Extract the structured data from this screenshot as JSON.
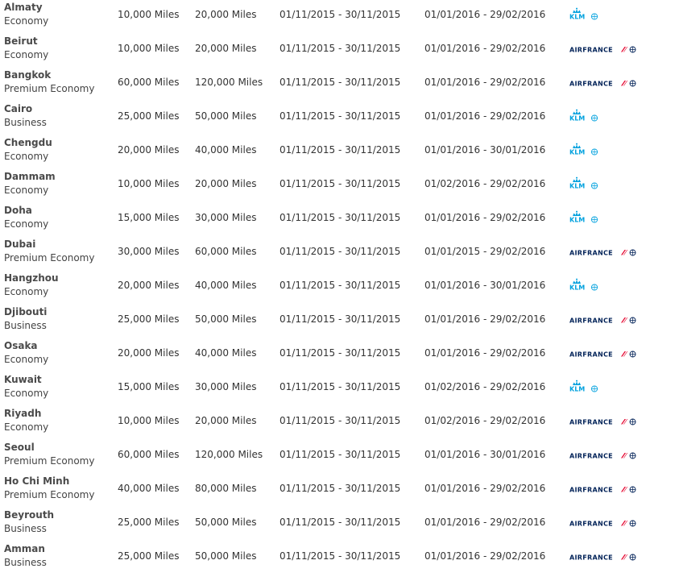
{
  "colors": {
    "klm_blue": "#00a1de",
    "airfrance_navy": "#002157",
    "airfrance_red": "#e4002b",
    "text": "#333333"
  },
  "rows": [
    {
      "city": "Almaty",
      "cabin": "Economy",
      "miles_low": "10,000 Miles",
      "miles_high": "20,000 Miles",
      "booking_period": "01/11/2015 - 30/11/2015",
      "travel_period": "01/01/2016 - 29/02/2016",
      "airline": "KLM",
      "logo_icon": "klm-logo-icon"
    },
    {
      "city": "Beirut",
      "cabin": "Economy",
      "miles_low": "10,000 Miles",
      "miles_high": "20,000 Miles",
      "booking_period": "01/11/2015 - 30/11/2015",
      "travel_period": "01/01/2016 - 29/02/2016",
      "airline": "AIRFRANCE",
      "logo_icon": "airfrance-logo-icon"
    },
    {
      "city": "Bangkok",
      "cabin": "Premium Economy",
      "miles_low": "60,000 Miles",
      "miles_high": "120,000 Miles",
      "booking_period": "01/11/2015 - 30/11/2015",
      "travel_period": "01/01/2016 - 29/02/2016",
      "airline": "AIRFRANCE",
      "logo_icon": "airfrance-logo-icon"
    },
    {
      "city": "Cairo",
      "cabin": "Business",
      "miles_low": "25,000 Miles",
      "miles_high": "50,000 Miles",
      "booking_period": "01/11/2015 - 30/11/2015",
      "travel_period": "01/01/2016 - 29/02/2016",
      "airline": "KLM",
      "logo_icon": "klm-logo-icon"
    },
    {
      "city": "Chengdu",
      "cabin": "Economy",
      "miles_low": "20,000 Miles",
      "miles_high": "40,000 Miles",
      "booking_period": "01/11/2015 - 30/11/2015",
      "travel_period": "01/01/2016 - 30/01/2016",
      "airline": "KLM",
      "logo_icon": "klm-logo-icon"
    },
    {
      "city": "Dammam",
      "cabin": "Economy",
      "miles_low": "10,000 Miles",
      "miles_high": "20,000 Miles",
      "booking_period": "01/11/2015 - 30/11/2015",
      "travel_period": "01/02/2016 - 29/02/2016",
      "airline": "KLM",
      "logo_icon": "klm-logo-icon"
    },
    {
      "city": "Doha",
      "cabin": "Economy",
      "miles_low": "15,000 Miles",
      "miles_high": "30,000 Miles",
      "booking_period": "01/11/2015 - 30/11/2015",
      "travel_period": "01/01/2016 - 29/02/2016",
      "airline": "KLM",
      "logo_icon": "klm-logo-icon"
    },
    {
      "city": "Dubai",
      "cabin": "Premium Economy",
      "miles_low": "30,000 Miles",
      "miles_high": "60,000 Miles",
      "booking_period": "01/11/2015 - 30/11/2015",
      "travel_period": "01/01/2015 - 29/02/2016",
      "airline": "AIRFRANCE",
      "logo_icon": "airfrance-logo-icon"
    },
    {
      "city": "Hangzhou",
      "cabin": "Economy",
      "miles_low": "20,000 Miles",
      "miles_high": "40,000 Miles",
      "booking_period": "01/11/2015 - 30/11/2015",
      "travel_period": "01/01/2016 - 30/01/2016",
      "airline": "KLM",
      "logo_icon": "klm-logo-icon"
    },
    {
      "city": "Djibouti",
      "cabin": "Business",
      "miles_low": "25,000 Miles",
      "miles_high": "50,000 Miles",
      "booking_period": "01/11/2015 - 30/11/2015",
      "travel_period": "01/01/2016 - 29/02/2016",
      "airline": "AIRFRANCE",
      "logo_icon": "airfrance-logo-icon"
    },
    {
      "city": "Osaka",
      "cabin": "Economy",
      "miles_low": "20,000 Miles",
      "miles_high": "40,000 Miles",
      "booking_period": "01/11/2015 - 30/11/2015",
      "travel_period": "01/01/2016 - 29/02/2016",
      "airline": "AIRFRANCE",
      "logo_icon": "airfrance-logo-icon"
    },
    {
      "city": "Kuwait",
      "cabin": "Economy",
      "miles_low": "15,000 Miles",
      "miles_high": "30,000 Miles",
      "booking_period": "01/11/2015 - 30/11/2015",
      "travel_period": "01/02/2016 - 29/02/2016",
      "airline": "KLM",
      "logo_icon": "klm-logo-icon"
    },
    {
      "city": "Riyadh",
      "cabin": "Economy",
      "miles_low": "10,000 Miles",
      "miles_high": "20,000 Miles",
      "booking_period": "01/11/2015 - 30/11/2015",
      "travel_period": "01/02/2016 - 29/02/2016",
      "airline": "AIRFRANCE",
      "logo_icon": "airfrance-logo-icon"
    },
    {
      "city": "Seoul",
      "cabin": "Premium Economy",
      "miles_low": "60,000 Miles",
      "miles_high": "120,000 Miles",
      "booking_period": "01/11/2015 - 30/11/2015",
      "travel_period": "01/01/2016 - 30/01/2016",
      "airline": "AIRFRANCE",
      "logo_icon": "airfrance-logo-icon"
    },
    {
      "city": "Ho Chi Minh",
      "cabin": "Premium Economy",
      "miles_low": "40,000 Miles",
      "miles_high": "80,000 Miles",
      "booking_period": "01/11/2015 - 30/11/2015",
      "travel_period": "01/01/2016 - 29/02/2016",
      "airline": "AIRFRANCE",
      "logo_icon": "airfrance-logo-icon"
    },
    {
      "city": "Beyrouth",
      "cabin": "Business",
      "miles_low": "25,000 Miles",
      "miles_high": "50,000 Miles",
      "booking_period": "01/11/2015 - 30/11/2015",
      "travel_period": "01/01/2016 - 29/02/2016",
      "airline": "AIRFRANCE",
      "logo_icon": "airfrance-logo-icon"
    },
    {
      "city": "Amman",
      "cabin": "Business",
      "miles_low": "25,000 Miles",
      "miles_high": "50,000 Miles",
      "booking_period": "01/11/2015 - 30/11/2015",
      "travel_period": "01/01/2016 - 29/02/2016",
      "airline": "AIRFRANCE",
      "logo_icon": "airfrance-logo-icon"
    }
  ]
}
